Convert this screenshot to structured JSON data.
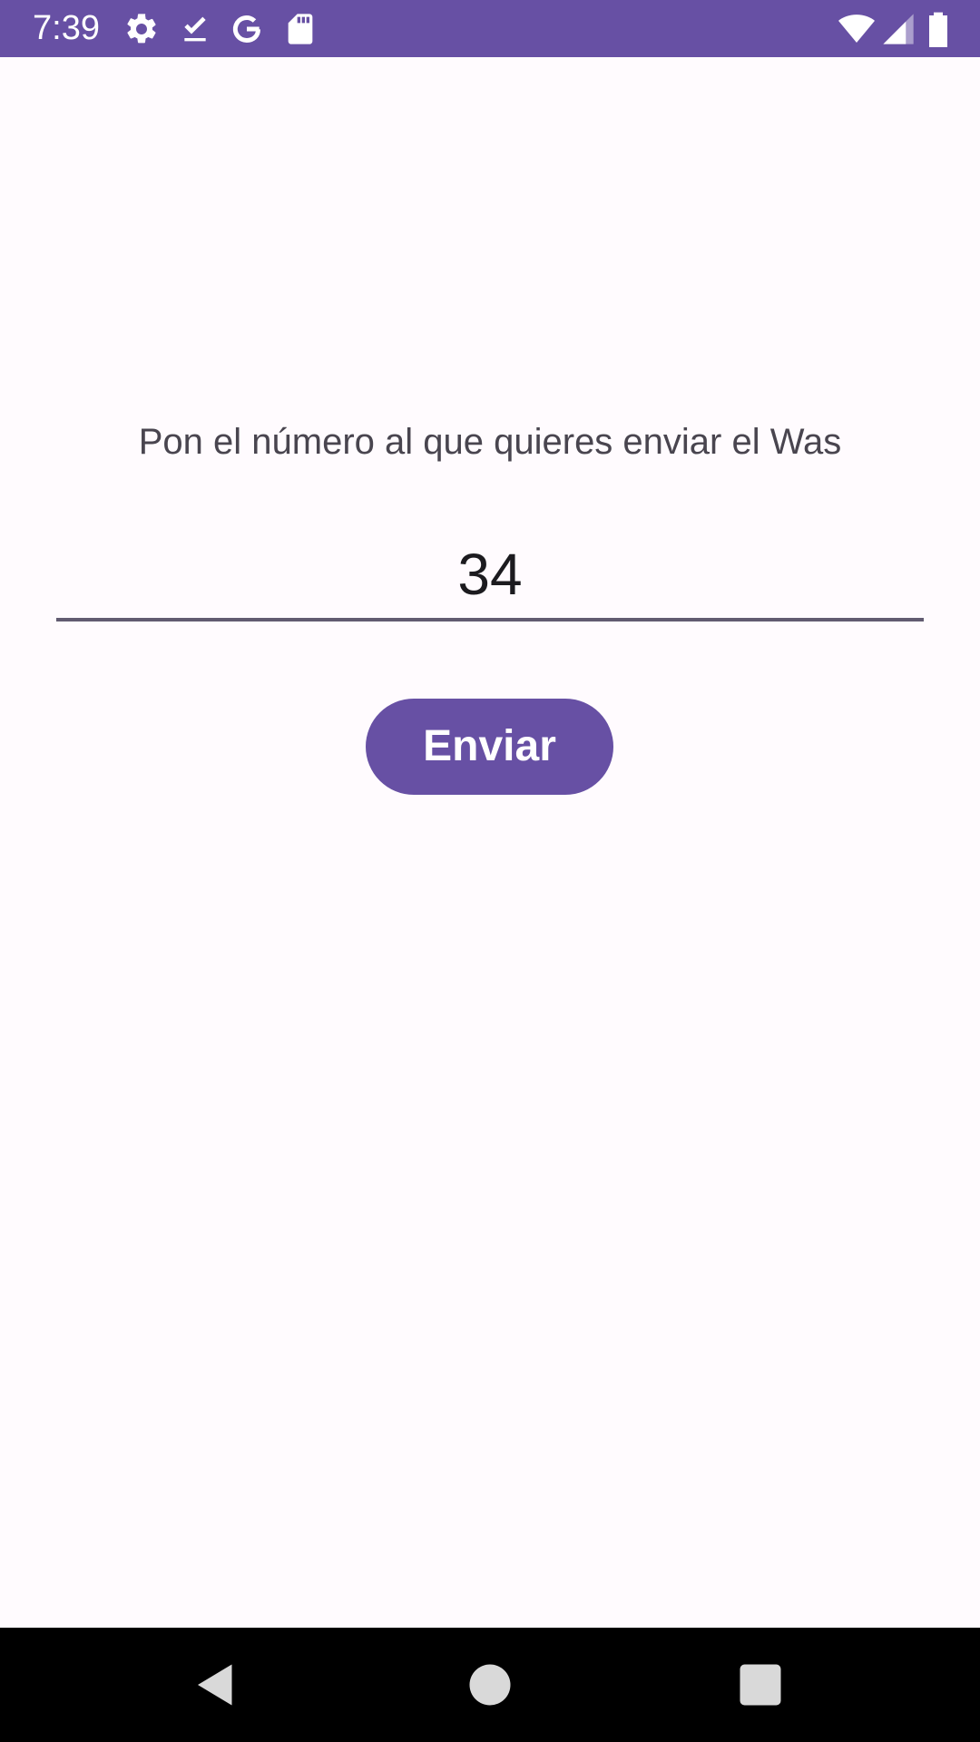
{
  "status_bar": {
    "time": "7:39",
    "background_color": "#6750A4",
    "left_icons": [
      "settings-icon",
      "download-done-icon",
      "google-icon",
      "sd-card-icon"
    ],
    "right_icons": [
      "wifi-icon",
      "cell-signal-icon",
      "battery-icon"
    ]
  },
  "main": {
    "prompt": "Pon el número al que quieres enviar el Was",
    "phone_input": {
      "value": "34"
    },
    "send_button": {
      "label": "Enviar",
      "color": "#6750A4"
    }
  },
  "nav_bar": {
    "buttons": [
      "back-icon",
      "home-icon",
      "recents-icon"
    ]
  }
}
